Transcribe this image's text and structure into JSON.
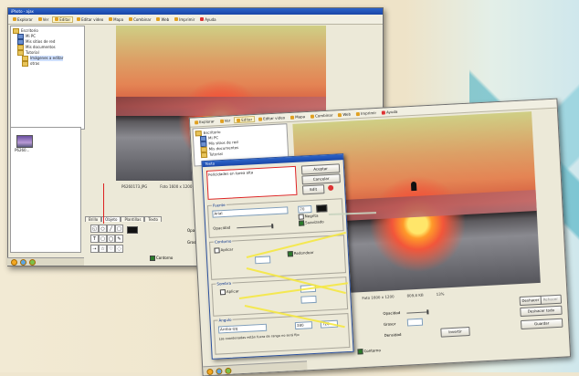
{
  "back_window": {
    "title": "iPhoto - ajax",
    "toolbar": [
      "Explorar",
      "Ver",
      "Editar",
      "Editar video",
      "Mapa",
      "Combinar",
      "Web",
      "Imprimir",
      "Ayuda"
    ],
    "tree": [
      "Escritorio",
      "Mi PC",
      "Mis sitios de red",
      "Mis documentos",
      "Tutorial",
      "Imágenes a editar",
      "otras"
    ],
    "thumb_label": "P6260...",
    "status_filename": "P6260173.JPG",
    "status_size": "Foto 1600 x 1200",
    "tabs": [
      "Brillo",
      "Objeto",
      "Plantillas",
      "Texto"
    ],
    "opacity_label": "Opacidad",
    "width_label": "Grosor",
    "border_label": "Contorno"
  },
  "front_window": {
    "toolbar": [
      "Explorar",
      "Ver",
      "Editar",
      "Editar video",
      "Mapa",
      "Combinar",
      "Web",
      "Imprimir",
      "Ayuda"
    ],
    "tree": [
      "Escritorio",
      "Mi PC",
      "Mis sitios de red",
      "Mis documentos",
      "Tutorial"
    ],
    "status_size": "Foto 1600 x 1200",
    "status_bytes": "809,8 KB",
    "zoom_label": "13%",
    "opacity_label": "Opacidad",
    "width_label": "Grosor",
    "density_label": "Densidad",
    "border_label": "Contorno",
    "invert_label": "Invertir",
    "right_buttons": [
      "Deshacer",
      "Deshacer todo",
      "Guardar"
    ],
    "right_buttons_extra": "Rehacer"
  },
  "text_dialog": {
    "title": "Texto",
    "text_value": "Felicidades en tarea alta",
    "btn_ok": "Aceptar",
    "btn_cancel": "Cancelar",
    "btn_edit": "Edit",
    "font_group": "Fuente",
    "font_name": "Arial",
    "font_size": "70",
    "bold_label": "Negrita",
    "antialias_label": "Suavizado",
    "opacity_label": "Opacidad",
    "shadow_group": "Contorno",
    "apply_label": "Aplicar",
    "round_label": "Redondear",
    "shadow2_group": "Sombra",
    "rotate_group": "Ángulo",
    "align_value": "Arriba-Izq",
    "coord_x": "380",
    "coord_y": "720",
    "note": "Las coordenadas están fuera de rango no será fijo"
  },
  "colors": {
    "title_bar": "#1a46a7",
    "highlight_yellow": "#f5e842",
    "annotation_red": "#d22222"
  }
}
